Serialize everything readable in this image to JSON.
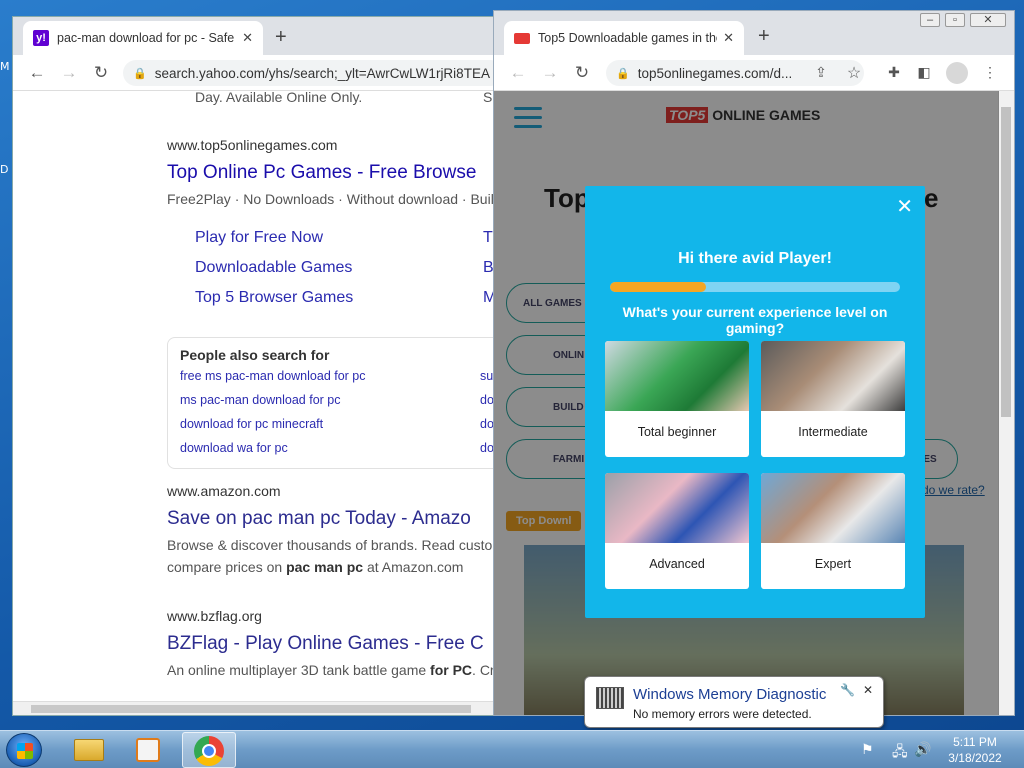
{
  "desktop": {
    "edge_letters": [
      "M",
      "D"
    ]
  },
  "left_window": {
    "tab_title": "pac-man download for pc - Safe",
    "url": "search.yahoo.com/yhs/search;_ylt=AwrCwLW1rjRi8TEA",
    "results": {
      "top_fragment": "Day. Available Online Only.",
      "top_fragment_right": "Sa",
      "r1": {
        "url": "www.top5onlinegames.com",
        "title": "Top Online Pc Games - Free Browse",
        "desc": "Free2Play · No Downloads · Without download · Build",
        "sitelinks": [
          "Play for Free Now",
          "Downloadable Games",
          "Top 5 Browser Games"
        ],
        "sitelinks_right": [
          "T",
          "B",
          "M"
        ]
      },
      "people_also_search": {
        "heading": "People also search for",
        "left": [
          "free ms pac-man download for pc",
          "ms pac-man download for pc",
          "download for pc minecraft",
          "download wa for pc"
        ],
        "right": [
          "su",
          "do",
          "do",
          "do"
        ]
      },
      "r2": {
        "url": "www.amazon.com",
        "title": "Save on pac man pc Today - Amazo",
        "desc1": "Browse & discover thousands of brands. Read custor",
        "desc2_pre": "compare prices on ",
        "desc2_bold": "pac man pc",
        "desc2_post": " at Amazon.com"
      },
      "r3": {
        "url": "www.bzflag.org",
        "title": "BZFlag - Play Online Games - Free C",
        "desc_pre": "An online multiplayer 3D tank battle game ",
        "desc_bold": "for PC",
        "desc_post": ". Cro"
      }
    }
  },
  "right_window": {
    "tab_title": "Top5 Downloadable games in the",
    "url": "top5onlinegames.com/d...",
    "page": {
      "logo_badge": "TOP5",
      "logo_text": "ONLINE GAMES",
      "hero_left": "Top",
      "hero_right": "e",
      "pills": [
        "ALL GAMES",
        "ONLIN",
        "BUILD",
        "FARMI"
      ],
      "pill_right_fragment": "MES",
      "tag": "Top Downl",
      "rate_link": "do we rate?"
    },
    "modal": {
      "heading": "Hi there avid Player!",
      "progress": 0.33,
      "question": "What's your current experience level on gaming?",
      "options": [
        "Total beginner",
        "Intermediate",
        "Advanced",
        "Expert"
      ]
    }
  },
  "notification": {
    "title": "Windows Memory Diagnostic",
    "message": "No memory errors were detected."
  },
  "clock": {
    "time": "5:11 PM",
    "date": "3/18/2022"
  },
  "colors": {
    "modal": "#12b6ea",
    "progress_fill": "#f5a623",
    "link": "#1a0dab"
  }
}
